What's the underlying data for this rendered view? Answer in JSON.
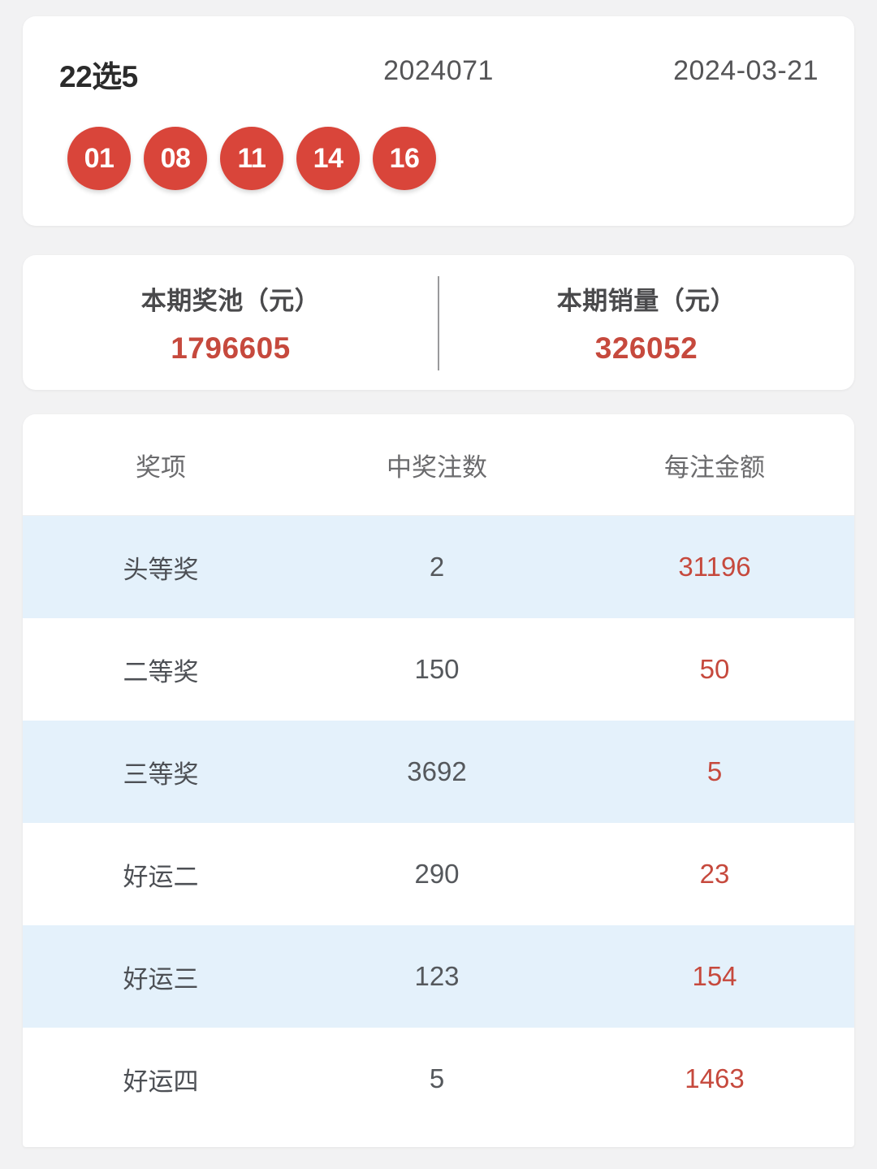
{
  "draw": {
    "game_name": "22选5",
    "issue": "2024071",
    "date": "2024-03-21",
    "numbers": [
      "01",
      "08",
      "11",
      "14",
      "16"
    ],
    "ball_color": "#d9453a"
  },
  "stats": {
    "pool": {
      "label": "本期奖池（元）",
      "value": "1796605"
    },
    "sales": {
      "label": "本期销量（元）",
      "value": "326052"
    },
    "value_color": "#c6493d"
  },
  "prize_table": {
    "columns": [
      "奖项",
      "中奖注数",
      "每注金额"
    ],
    "rows": [
      {
        "name": "头等奖",
        "count": "2",
        "amount": "31196"
      },
      {
        "name": "二等奖",
        "count": "150",
        "amount": "50"
      },
      {
        "name": "三等奖",
        "count": "3692",
        "amount": "5"
      },
      {
        "name": "好运二",
        "count": "290",
        "amount": "23"
      },
      {
        "name": "好运三",
        "count": "123",
        "amount": "154"
      },
      {
        "name": "好运四",
        "count": "5",
        "amount": "1463"
      }
    ],
    "alt_row_color": "#e4f1fb",
    "amount_color": "#c6493d"
  }
}
